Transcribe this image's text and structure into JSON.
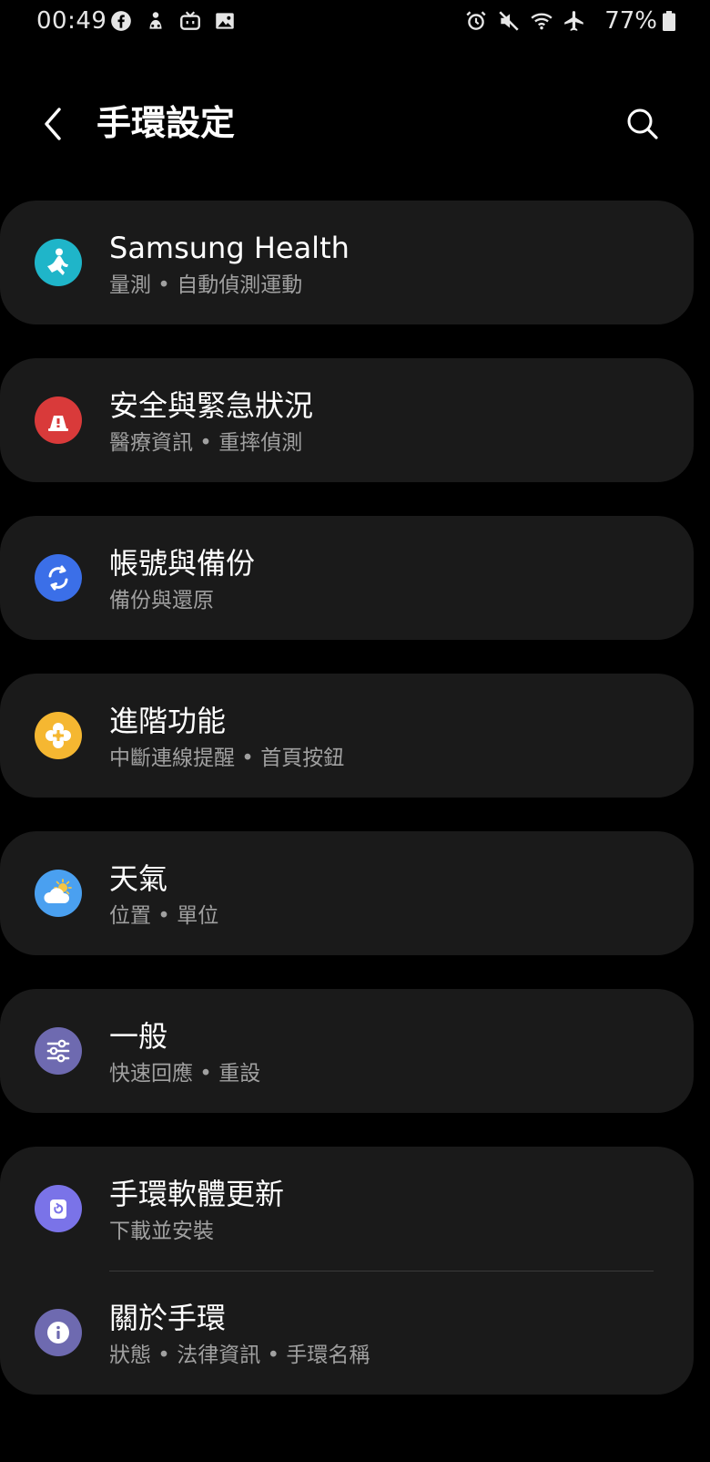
{
  "status_bar": {
    "time": "00:49",
    "battery_text": "77%",
    "left_icons": [
      "facebook-icon",
      "app-icon",
      "tv-icon",
      "image-icon"
    ],
    "right_icons": [
      "alarm-icon",
      "mute-icon",
      "wifi-icon",
      "airplane-icon",
      "battery-icon"
    ]
  },
  "header": {
    "title": "手環設定",
    "back_icon": "chevron-left-icon",
    "search_icon": "search-icon"
  },
  "colors": {
    "background": "#000000",
    "card": "#1a1a1a",
    "subtitle": "#a0a0a0",
    "health_icon": "#1fb5c9",
    "safety_icon": "#d93a3a",
    "account_icon": "#3b6fe8",
    "advanced_icon": "#f5b731",
    "weather_icon": "#4aa0f0",
    "general_icon": "#6e6ab0",
    "update_icon": "#7a73e8",
    "about_icon": "#6e6ab0"
  },
  "settings": [
    {
      "icon": "samsung-health-icon",
      "title": "Samsung Health",
      "subtitle": "量測 • 自動偵測運動"
    },
    {
      "icon": "safety-icon",
      "title": "安全與緊急狀況",
      "subtitle": "醫療資訊 • 重摔偵測"
    },
    {
      "icon": "sync-icon",
      "title": "帳號與備份",
      "subtitle": "備份與還原"
    },
    {
      "icon": "advanced-features-icon",
      "title": "進階功能",
      "subtitle": "中斷連線提醒 • 首頁按鈕"
    },
    {
      "icon": "weather-icon",
      "title": "天氣",
      "subtitle": "位置 • 單位"
    },
    {
      "icon": "sliders-icon",
      "title": "一般",
      "subtitle": "快速回應 • 重設"
    },
    {
      "icon": "software-update-icon",
      "title": "手環軟體更新",
      "subtitle": "下載並安裝"
    },
    {
      "icon": "info-icon",
      "title": "關於手環",
      "subtitle": "狀態 • 法律資訊 • 手環名稱"
    }
  ]
}
